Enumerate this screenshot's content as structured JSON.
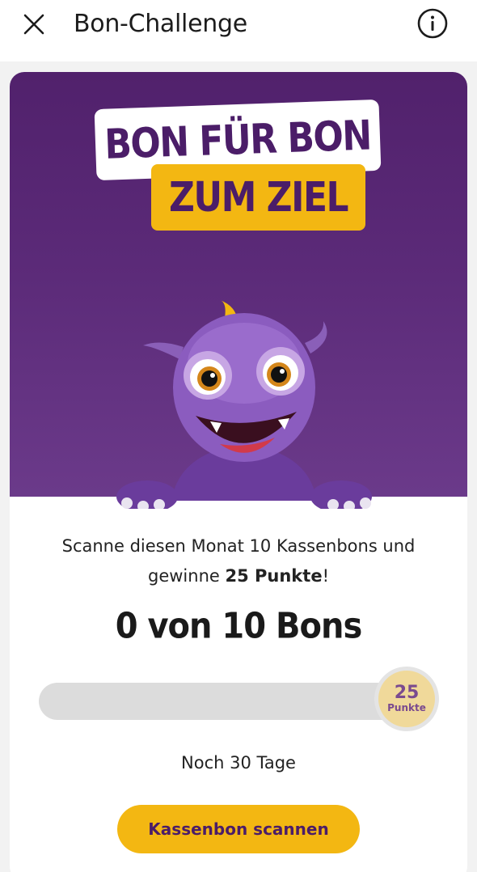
{
  "header": {
    "title": "Bon-Challenge",
    "close_icon": "close-icon",
    "info_icon": "info-icon"
  },
  "hero": {
    "banner_line1": "BON FÜR BON",
    "banner_line2": "ZUM ZIEL",
    "background_color": "#5b2a78",
    "accent_color": "#f3b712"
  },
  "challenge": {
    "description_part1": "Scanne diesen Monat 10 Kassenbons und gewinne ",
    "description_bold": "25 Punkte",
    "description_part2": "!",
    "progress_text": "0 von 10 Bons",
    "progress_current": 0,
    "progress_total": 10,
    "reward_points": "25",
    "reward_unit": "Punkte",
    "remaining": "Noch 30 Tage"
  },
  "actions": {
    "scan_button": "Kassenbon scannen"
  }
}
